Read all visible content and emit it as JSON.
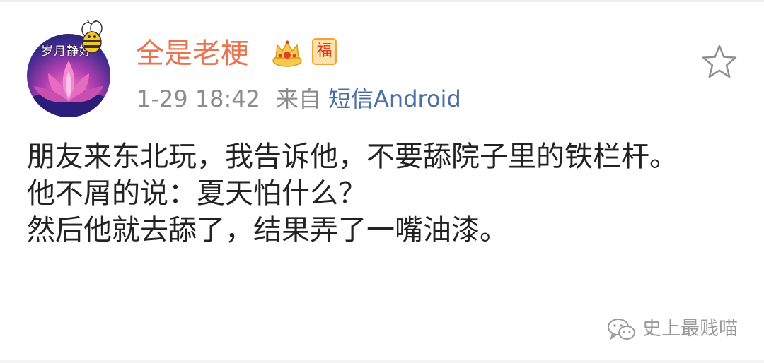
{
  "post": {
    "avatar_label": "岁月静好",
    "username": "全是老梗",
    "badge_fu": "福",
    "time": "1-29 18:42",
    "from_label": "来自",
    "source": "短信Android",
    "content": [
      "朋友来东北玩，我告诉他，不要舔院子里的铁栏杆。",
      "他不屑的说：夏天怕什么？",
      "然后他就去舔了，结果弄了一嘴油漆。"
    ]
  },
  "watermark": {
    "text": "史上最贱喵"
  },
  "colors": {
    "username": "#eb7350",
    "source_link": "#4a6fa5",
    "meta": "#8c8c8c",
    "text": "#222222"
  },
  "icons": [
    "bee-icon",
    "crown-icon",
    "star-icon",
    "wechat-icon"
  ]
}
